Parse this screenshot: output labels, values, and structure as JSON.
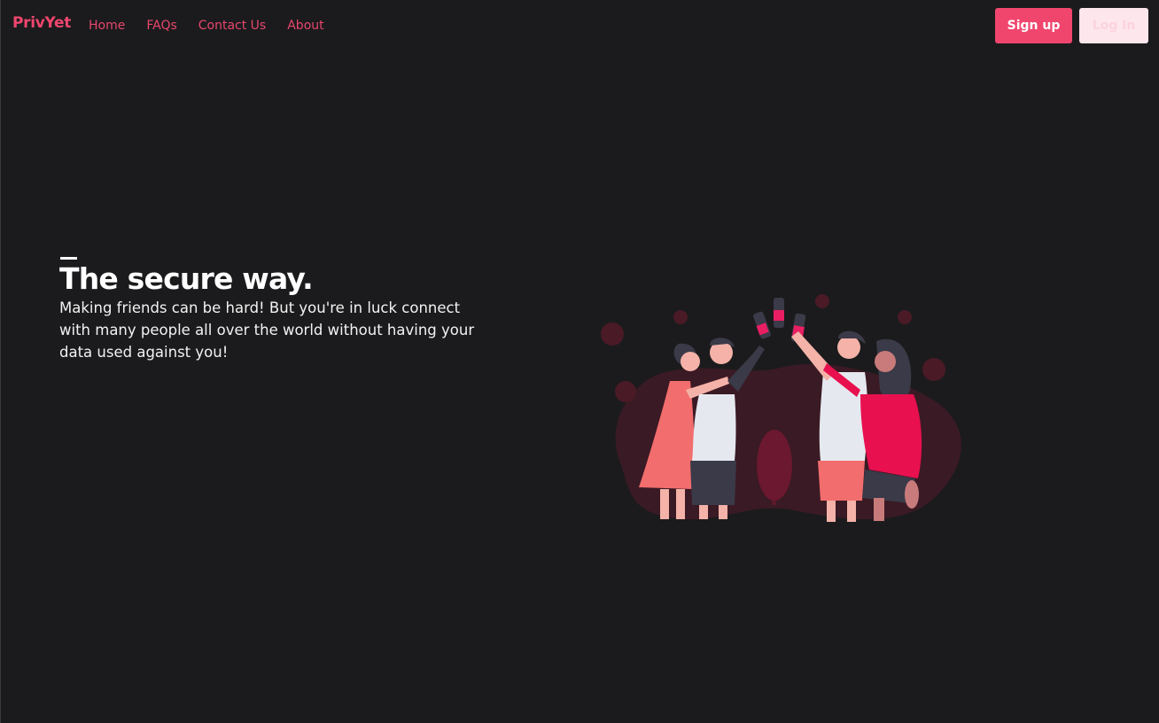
{
  "nav": {
    "brand": "PrivYet",
    "links": [
      "Home",
      "FAQs",
      "Contact Us",
      "About"
    ],
    "signup_label": "Sign up",
    "login_label": "Log In"
  },
  "hero": {
    "title": "The secure way.",
    "description": "Making friends can be hard! But you're in luck connect with many people all over the world without having your data used against you!",
    "illustration_icon": "friends-celebrating-illustration"
  },
  "colors": {
    "background": "#1b1b1d",
    "accent": "#f0466e",
    "login_bg": "#fde6ec"
  }
}
